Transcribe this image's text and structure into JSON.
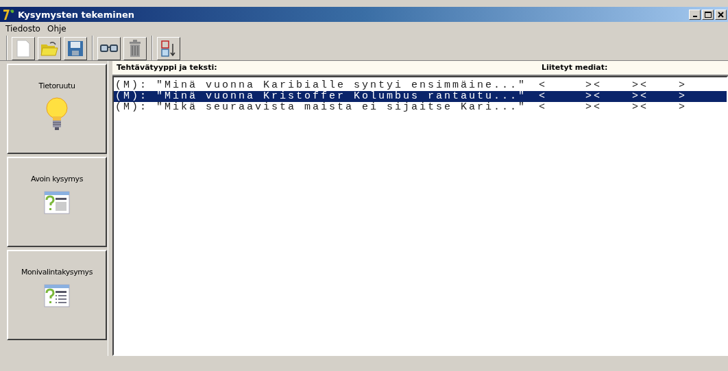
{
  "window": {
    "title": "Kysymysten tekeminen"
  },
  "menu": [
    "Tiedosto",
    "Ohje"
  ],
  "sidebar": {
    "items": [
      {
        "label": "Tietoruutu",
        "kind": "info"
      },
      {
        "label": "Avoin kysymys",
        "kind": "open"
      },
      {
        "label": "Monivalintakysymys",
        "kind": "choice"
      }
    ]
  },
  "table": {
    "columns": [
      "Tehtävätyyppi ja teksti:",
      "Liitetyt mediat:"
    ],
    "rows": [
      {
        "text": "(M): \"Minä vuonna Karibialle syntyi ensimmäine...\"",
        "media": [
          "<",
          "><",
          "><",
          ">"
        ],
        "selected": false
      },
      {
        "text": "(M): \"Minä vuonna Kristoffer Kolumbus rantautu...\"",
        "media": [
          "<",
          "><",
          "><",
          ">"
        ],
        "selected": true
      },
      {
        "text": "(M): \"Mikä seuraavista maista ei sijaitse Kari...\"",
        "media": [
          "<",
          "><",
          "><",
          ">"
        ],
        "selected": false
      }
    ]
  }
}
